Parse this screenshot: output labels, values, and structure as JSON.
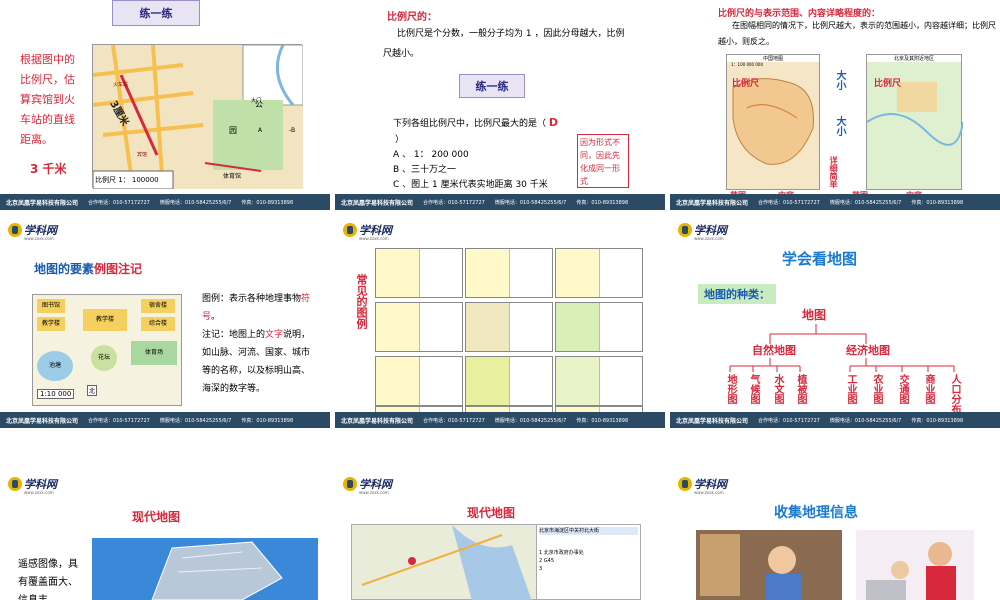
{
  "footer": {
    "company": "北京凤凰学易科技有限公司",
    "phone1": "合作电话：010-57172727",
    "phone2": "微服电话：010-58425255/6/7",
    "fax": "传真：010-89313898"
  },
  "logo": {
    "name": "学科网",
    "url": "www.zxxk.com"
  },
  "slide1": {
    "tag": "练一练",
    "question": "根据图中的比例尺，估算宾馆到火车站的直线距离。",
    "answer": "3 千米",
    "map_scale": "比例尺 1： 100000",
    "map_measure": "3厘米",
    "map_labels": {
      "station": "火车站",
      "hotel": "宾馆",
      "gym": "体育馆",
      "park": "公",
      "garden": "园",
      "gate": "大门",
      "a": "A",
      "b": "-B"
    }
  },
  "slide2": {
    "title": "比例尺的：",
    "desc": "比例尺是个分数，一般分子均为 1 ，因此分母越大，比例尺越小。",
    "tag": "练一练",
    "question": "下列各组比例尺中，比例尺最大的是（",
    "question_end": "）",
    "answer": "D",
    "options": [
      "A 、 1： 200 000",
      "B 、三十万之一",
      "C 、图上 1 厘米代表实地距离 30 千米"
    ],
    "note": "因为形式不同，因此先化成同一形式"
  },
  "slide3": {
    "title": "比例尺的与表示范围、内容详略程度的：",
    "desc": "在图幅相同的情况下，比例尺越大，表示的范围越小，内容越详细；比例尺越小，则反之。",
    "map_left_title": "中国地图",
    "map_left_scale": "1：100 000 000",
    "map_right_title": "北京及其附近地区",
    "labels": {
      "scale_word_l": "比例尺",
      "scale_word_r": "比例尺",
      "big_small_1": "大小",
      "big_small_2": "大小",
      "detail": "详细简单",
      "range_l": "范围",
      "content_l": "内容",
      "range_r": "范围",
      "content_r": "内容"
    }
  },
  "slide4": {
    "title_a": "地图的要素",
    "title_b": "例图注记",
    "legend_text_1": "图例：表示各种地理事物",
    "legend_text_1_red": "符号",
    "legend_text_2a": "注记：地图上的",
    "legend_text_2_red": "文字",
    "legend_text_2b": "说明，如山脉、河流、国家、城市等的名称，以及标明山高、海深的数字等。",
    "map_labels": [
      "图书馆",
      "宿舍楼",
      "教学楼",
      "综合楼",
      "教学楼",
      "池塘",
      "花坛",
      "体育场"
    ],
    "map_scale": "1:10 000",
    "north": "北"
  },
  "slide5": {
    "side_title": "常见的图例"
  },
  "slide6": {
    "title": "学会看地图",
    "kinds": "地图的种类：",
    "root": "地图",
    "branches": [
      "自然地图",
      "经济地图"
    ],
    "natural": [
      "地形图",
      "气候图",
      "水文图",
      "植被图"
    ],
    "economic": [
      "工业图",
      "农业图",
      "交通图",
      "商业图",
      "人口分布图"
    ]
  },
  "slide7": {
    "title": "现代地图",
    "desc": "遥感图像，具有覆盖面大、信息丰"
  },
  "slide8": {
    "title": "现代地图",
    "search_title": "北京市海淀区中关村北大街",
    "result_1": "1 北京市政府办事处",
    "result_2": "2 G45",
    "result_3": "3"
  },
  "slide9": {
    "title": "收集地理信息"
  },
  "colors": {
    "accent_red": "#d8283c",
    "footer_bg": "#2a4a66",
    "tag_bg": "#e8e4f4",
    "title_blue": "#1a5ab0"
  }
}
